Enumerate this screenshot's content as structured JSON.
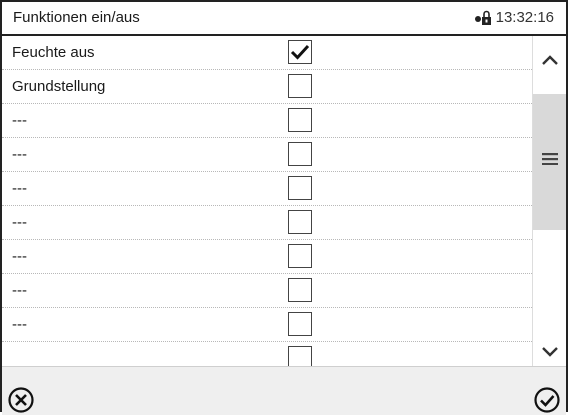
{
  "header": {
    "title": "Funktionen ein/aus",
    "time": "13:32:16",
    "lock_icon": "lock-icon"
  },
  "functions": [
    {
      "label": "Feuchte aus",
      "checked": true
    },
    {
      "label": "Grundstellung",
      "checked": false
    },
    {
      "label": "---",
      "checked": false
    },
    {
      "label": "---",
      "checked": false
    },
    {
      "label": "---",
      "checked": false
    },
    {
      "label": "---",
      "checked": false
    },
    {
      "label": "---",
      "checked": false
    },
    {
      "label": "---",
      "checked": false
    },
    {
      "label": "---",
      "checked": false
    },
    {
      "label": "",
      "checked": false
    }
  ],
  "scrollbar": {
    "up_icon": "chevron-up-icon",
    "grip_icon": "menu-grip-icon",
    "down_icon": "chevron-down-icon"
  },
  "footer": {
    "cancel_icon": "cancel-circle-icon",
    "confirm_icon": "confirm-circle-icon"
  }
}
